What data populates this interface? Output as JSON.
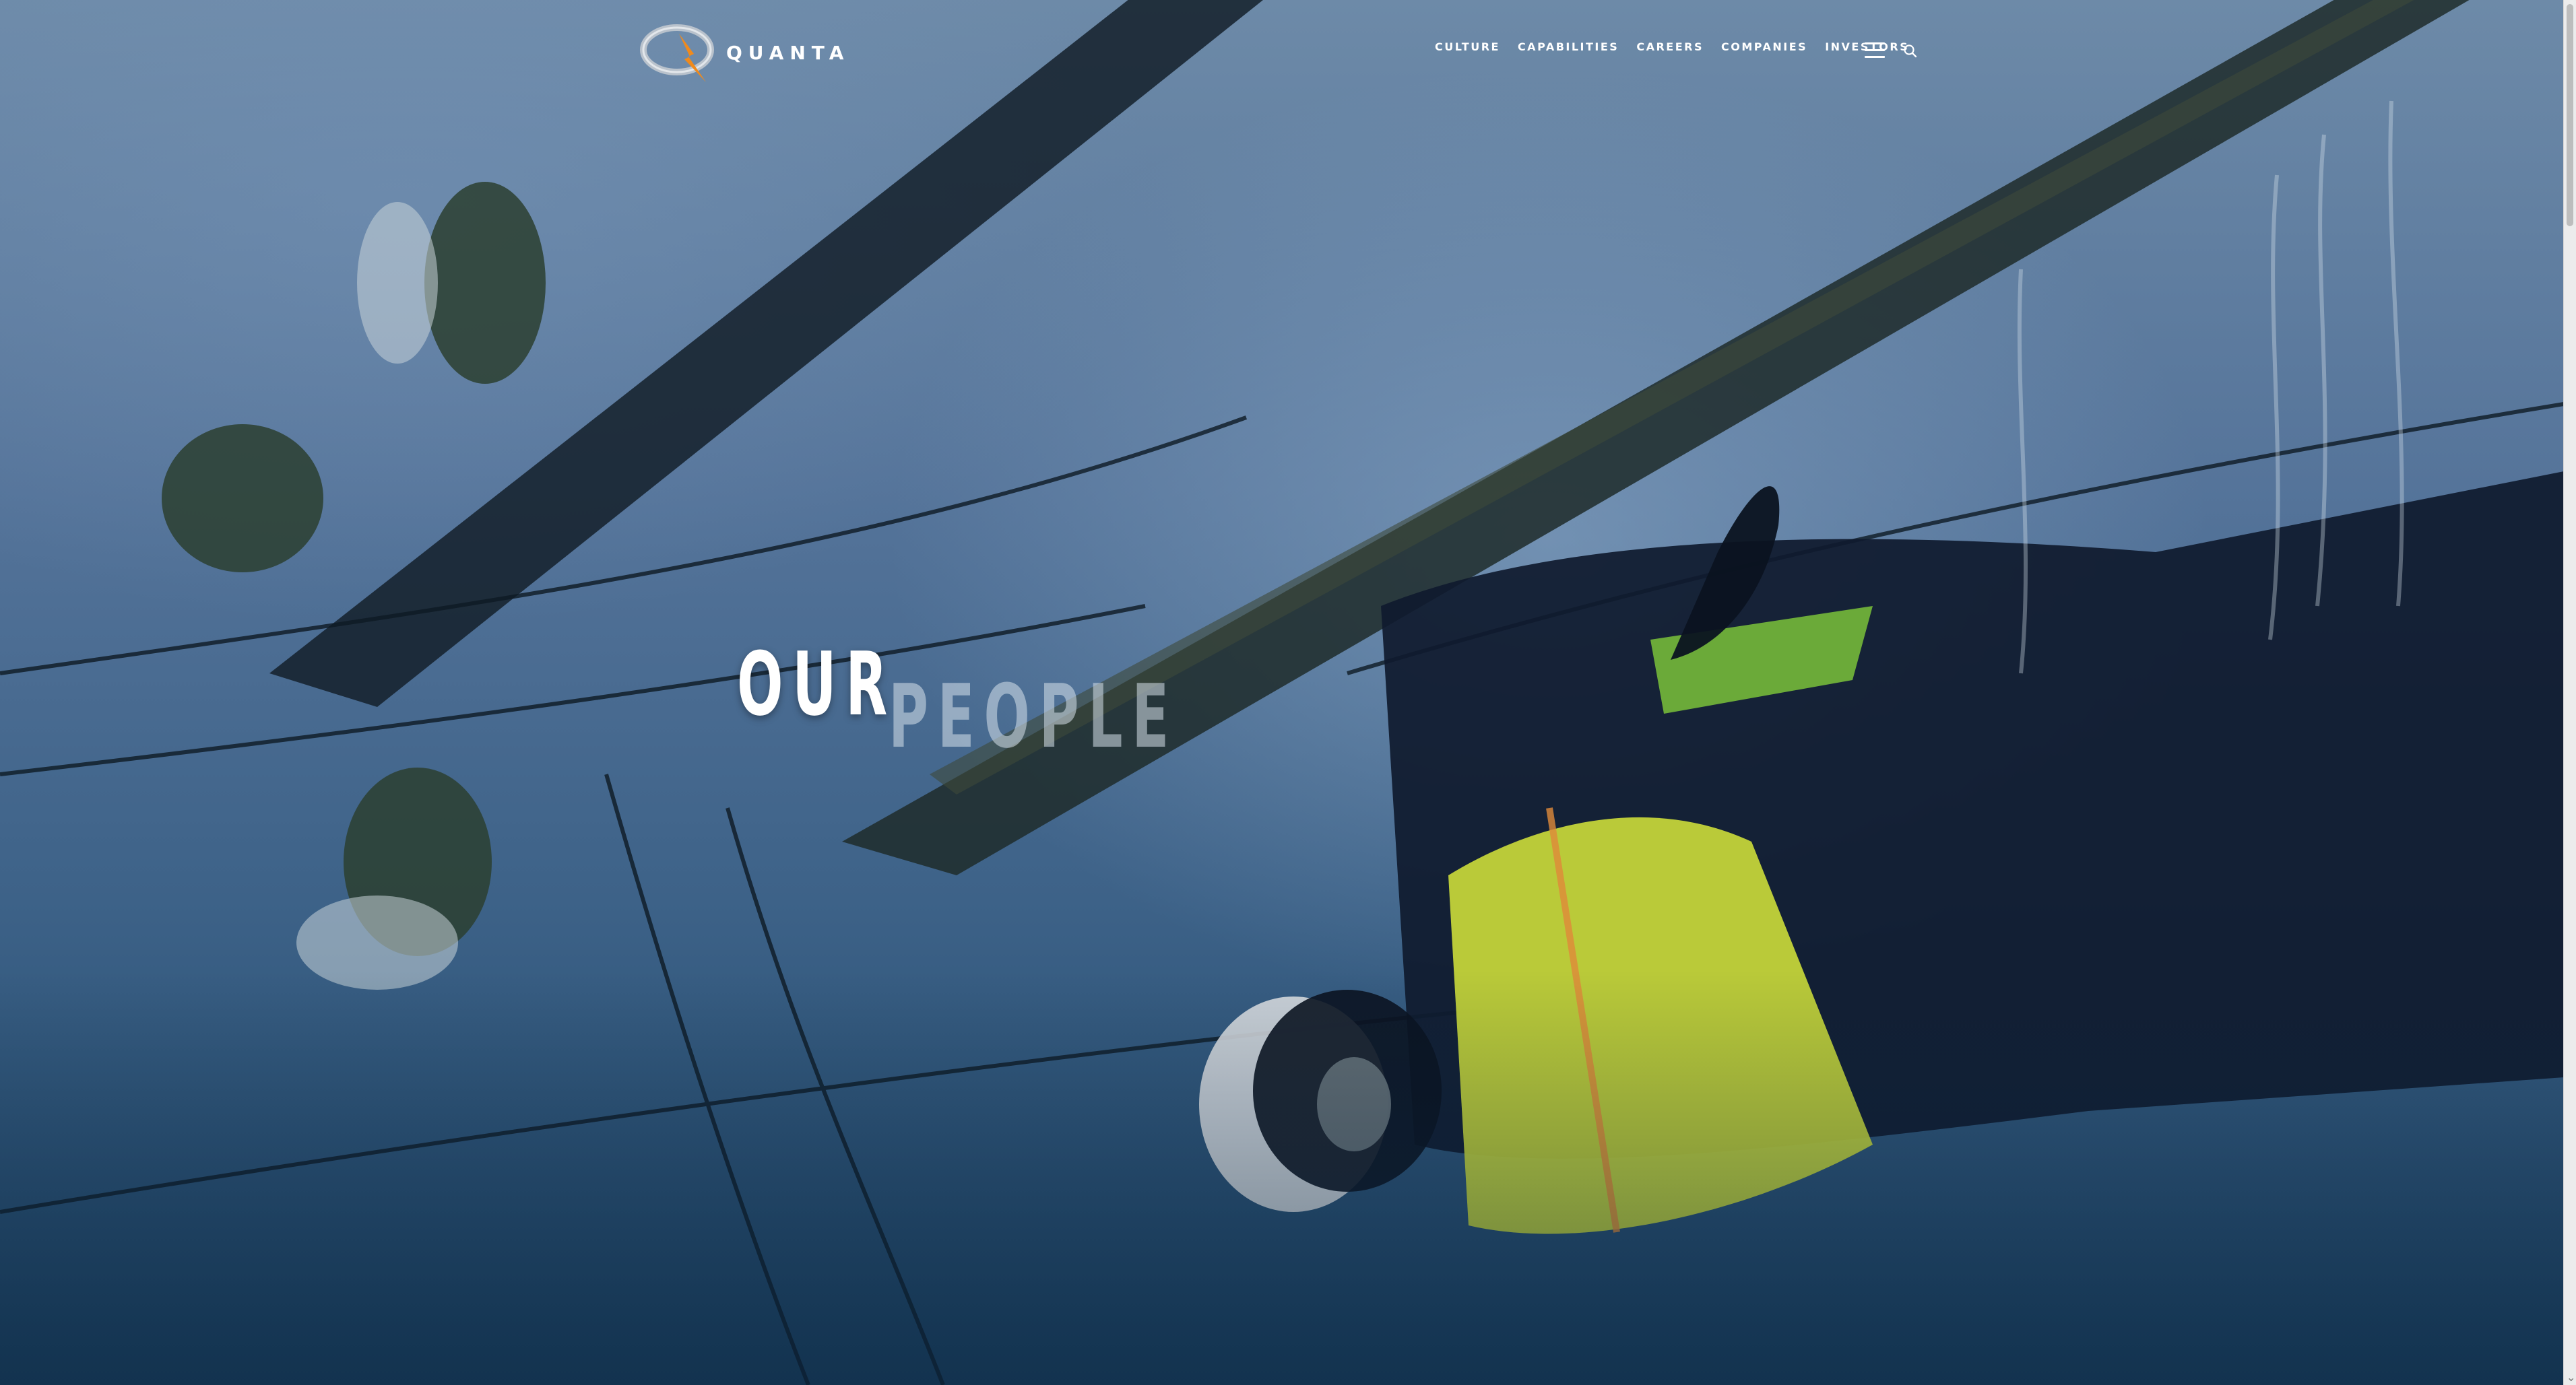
{
  "header": {
    "logo_text": "QUANTA",
    "logo_icon": "quanta-swirl-logo",
    "nav": [
      {
        "label": "CULTURE"
      },
      {
        "label": "CAPABILITIES"
      },
      {
        "label": "CAREERS"
      },
      {
        "label": "COMPANIES"
      },
      {
        "label": "INVESTORS"
      }
    ],
    "menu_icon": "hamburger-menu-icon",
    "search_icon": "search-icon"
  },
  "hero": {
    "headline_primary": "OUR",
    "headline_secondary": "PEOPLE"
  },
  "colors": {
    "text": "#ffffff",
    "logo_orange": "#f08a1c",
    "logo_silver": "#b9c2cc",
    "vest_yellow": "#c9d93a"
  }
}
